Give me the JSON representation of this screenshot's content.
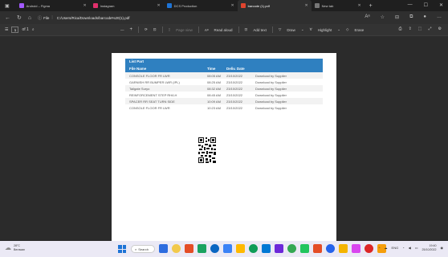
{
  "browser": {
    "tabs": [
      {
        "label": "Android – Figma",
        "color": "#a259ff"
      },
      {
        "label": "Instagram",
        "color": "#e1306c"
      },
      {
        "label": "DCS Production",
        "color": "#1e74d6"
      },
      {
        "label": "barcode (1).pdf",
        "color": "#e0442e",
        "active": true
      },
      {
        "label": "New tab",
        "color": "#777777"
      }
    ],
    "url_label": "File",
    "url": "C:/Users/Rica/Downloads/barcode%20(1).pdf"
  },
  "pdf_toolbar": {
    "page_current": "1",
    "page_total": "of 1",
    "zoom_out": "—",
    "zoom_in": "+",
    "page_view": "Page view",
    "read_aloud": "Read aloud",
    "add_text": "Add text",
    "draw": "Draw",
    "highlight": "Highlight",
    "erase": "Erase"
  },
  "document": {
    "table_title": "List Part",
    "headers": [
      "File Name",
      "Time",
      "Deliv. Date",
      ""
    ],
    "rows": [
      [
        "CONSOLE FLOOR FR LWR",
        "08:05 AM",
        "23/10/2022",
        "Download by Supplier"
      ],
      [
        "GARNISH RR BUMPER LWR (IPL)",
        "08:25 AM",
        "23/10/2022",
        "Download by Supplier"
      ],
      [
        "Tailgate Suryo",
        "08:32 AM",
        "23/10/2022",
        "Download by Supplier"
      ],
      [
        "REINFORCEMENT STEP RH/LH",
        "08:45 AM",
        "23/10/2022",
        "Download by Supplier"
      ],
      [
        "SPACER RR SEAT TURN SIDE",
        "10:09 AM",
        "23/10/2022",
        "Download by Supplier"
      ],
      [
        "CONSOLE FLOOR FR LWR",
        "10:23 AM",
        "23/10/2022",
        "Download by Supplier"
      ]
    ]
  },
  "taskbar": {
    "weather_temp": "28°C",
    "weather_desc": "Berawan",
    "search_label": "Search",
    "lang": "ENG",
    "time": "19:40",
    "date": "25/10/2022",
    "apps": [
      "#2d6cdf",
      "#f2c94c",
      "#e44d26",
      "#1aa260",
      "#0a66c2",
      "#3b82f6",
      "#ffb900",
      "#0f9d58",
      "#0078d4",
      "#6d28d9",
      "#34a853",
      "#22c55e",
      "#e44d26",
      "#2563eb",
      "#f4b400",
      "#d946ef",
      "#dc2626",
      "#f59e0b"
    ]
  }
}
